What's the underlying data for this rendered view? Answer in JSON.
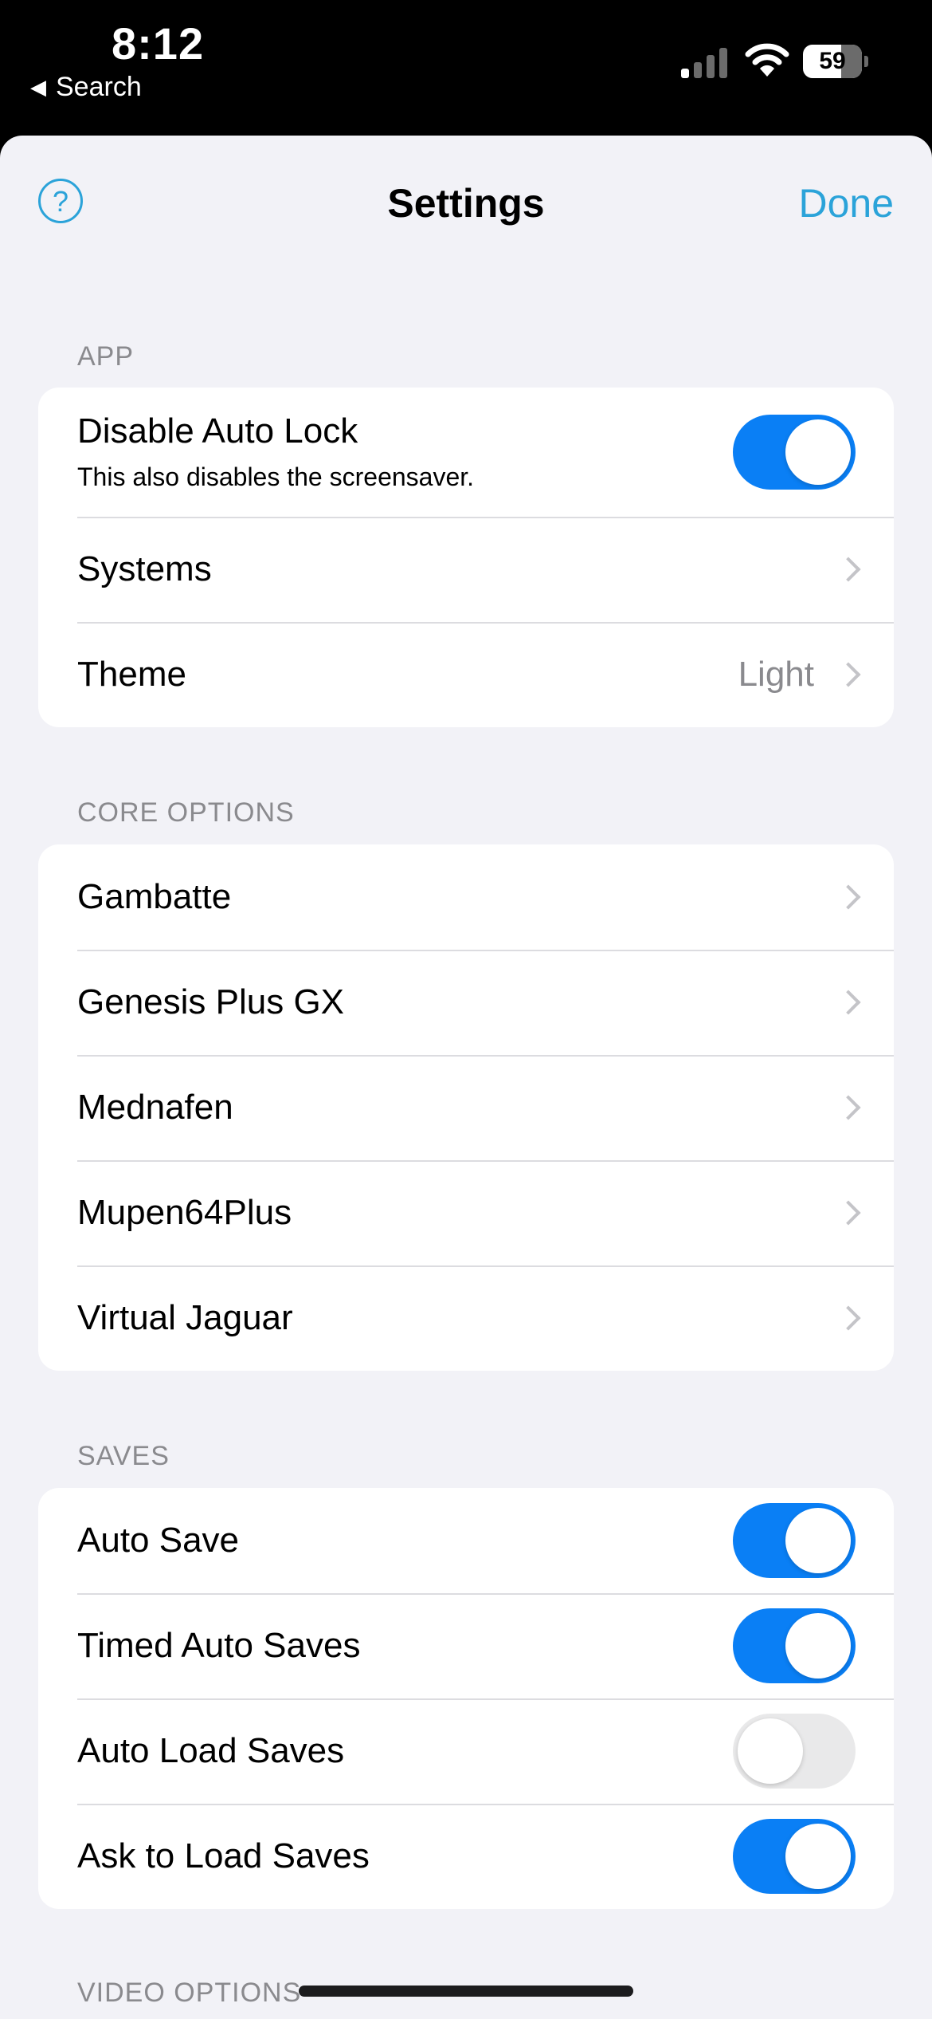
{
  "status_bar": {
    "time": "8:12",
    "back_label": "Search",
    "battery": "59"
  },
  "nav": {
    "title": "Settings",
    "help_label": "?",
    "done_label": "Done"
  },
  "colors": {
    "accent": "#2ba3d9",
    "toggle_on": "#0a7ff5",
    "toggle_off": "#e9e9ea",
    "background": "#f2f2f7"
  },
  "app_section": {
    "header": "APP",
    "auto_lock": {
      "label": "Disable Auto Lock",
      "subtitle": "This also disables the screensaver.",
      "on": true
    },
    "systems": {
      "label": "Systems"
    },
    "theme": {
      "label": "Theme",
      "value": "Light"
    }
  },
  "core_section": {
    "header": "CORE OPTIONS",
    "items": [
      {
        "label": "Gambatte"
      },
      {
        "label": "Genesis Plus GX"
      },
      {
        "label": "Mednafen"
      },
      {
        "label": "Mupen64Plus"
      },
      {
        "label": "Virtual Jaguar"
      }
    ]
  },
  "saves_section": {
    "header": "SAVES",
    "items": [
      {
        "label": "Auto Save",
        "on": true
      },
      {
        "label": "Timed Auto Saves",
        "on": true
      },
      {
        "label": "Auto Load Saves",
        "on": false
      },
      {
        "label": "Ask to Load Saves",
        "on": true
      }
    ]
  },
  "video_section": {
    "header": "VIDEO OPTIONS"
  }
}
